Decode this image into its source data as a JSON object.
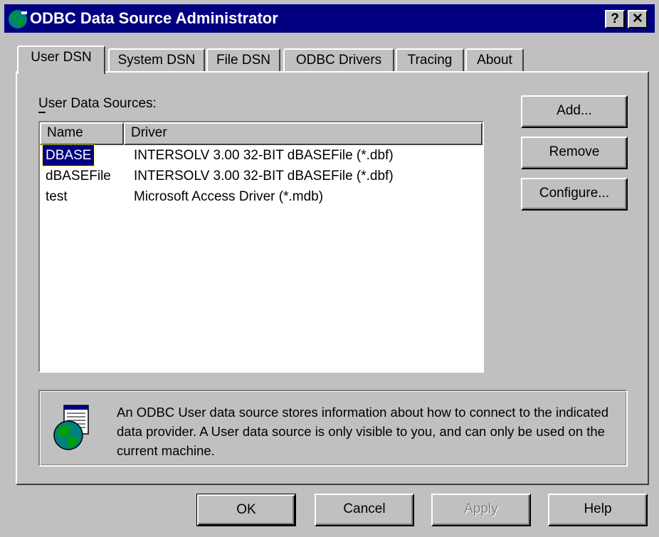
{
  "window": {
    "title": "ODBC Data Source Administrator",
    "help_glyph": "?",
    "close_glyph": "✕"
  },
  "tabs": [
    {
      "label": "User DSN",
      "active": true
    },
    {
      "label": "System DSN",
      "active": false
    },
    {
      "label": "File DSN",
      "active": false
    },
    {
      "label": "ODBC Drivers",
      "active": false
    },
    {
      "label": "Tracing",
      "active": false
    },
    {
      "label": "About",
      "active": false
    }
  ],
  "user_dsn": {
    "section_label": "User Data Sources:",
    "columns": [
      "Name",
      "Driver"
    ],
    "rows": [
      {
        "name": "DBASE",
        "driver": "INTERSOLV 3.00 32-BIT dBASEFile (*.dbf)",
        "selected": true
      },
      {
        "name": "dBASEFile",
        "driver": "INTERSOLV 3.00 32-BIT dBASEFile (*.dbf)",
        "selected": false
      },
      {
        "name": "test",
        "driver": "Microsoft Access Driver (*.mdb)",
        "selected": false
      }
    ],
    "buttons": {
      "add": "Add...",
      "remove": "Remove",
      "configure": "Configure..."
    },
    "info_text": "An ODBC User data source stores information about how to connect to the indicated data provider.   A User data source is only visible to you, and can only be used on the current machine."
  },
  "dialog_buttons": {
    "ok": "OK",
    "cancel": "Cancel",
    "apply": "Apply",
    "help": "Help"
  },
  "icons": {
    "title_icon": "globe-icon",
    "info_icon": "globe-datasource-icon"
  },
  "colors": {
    "title_bar": "#000080",
    "face": "#c0c0c0",
    "selection": "#000080"
  }
}
